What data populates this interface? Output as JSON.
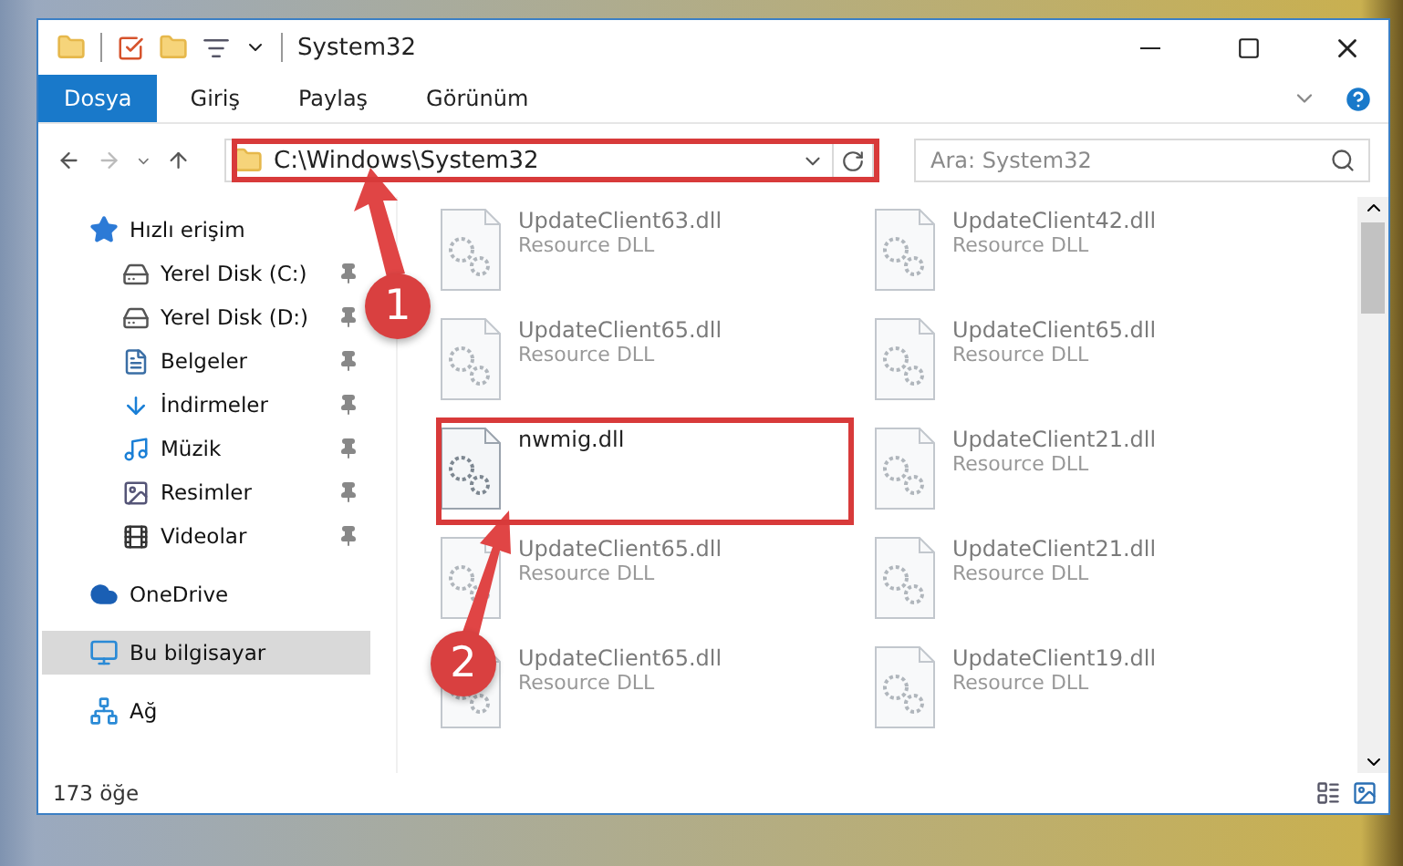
{
  "window": {
    "title": "System32"
  },
  "ribbon_tabs": [
    {
      "label": "Dosya",
      "selected": true
    },
    {
      "label": "Giriş",
      "selected": false
    },
    {
      "label": "Paylaş",
      "selected": false
    },
    {
      "label": "Görünüm",
      "selected": false
    }
  ],
  "address": {
    "path": "C:\\Windows\\System32"
  },
  "search": {
    "placeholder": "Ara: System32"
  },
  "sidebar": {
    "items": [
      {
        "label": "Hızlı erişim",
        "selected": false,
        "children": [
          {
            "label": "Yerel Disk (C:)",
            "pinned": true
          },
          {
            "label": "Yerel Disk (D:)",
            "pinned": true
          },
          {
            "label": "Belgeler",
            "pinned": true
          },
          {
            "label": "İndirmeler",
            "pinned": true
          },
          {
            "label": "Müzik",
            "pinned": true
          },
          {
            "label": "Resimler",
            "pinned": true
          },
          {
            "label": "Videolar",
            "pinned": true
          }
        ]
      },
      {
        "label": "OneDrive",
        "selected": false
      },
      {
        "label": "Bu bilgisayar",
        "selected": true
      },
      {
        "label": "Ağ",
        "selected": false
      }
    ]
  },
  "files": [
    {
      "name": "UpdateClient63.dll",
      "type": "Resource DLL",
      "dimmed": true
    },
    {
      "name": "UpdateClient42.dll",
      "type": "Resource DLL",
      "dimmed": true
    },
    {
      "name": "UpdateClient65.dll",
      "type": "Resource DLL",
      "dimmed": true
    },
    {
      "name": "UpdateClient65.dll",
      "type": "Resource DLL",
      "dimmed": true
    },
    {
      "name": "nwmig.dll",
      "dimmed": false
    },
    {
      "name": "UpdateClient21.dll",
      "type": "Resource DLL",
      "dimmed": true
    },
    {
      "name": "UpdateClient65.dll",
      "type": "Resource DLL",
      "dimmed": true
    },
    {
      "name": "UpdateClient21.dll",
      "type": "Resource DLL",
      "dimmed": true
    },
    {
      "name": "UpdateClient65.dll",
      "type": "Resource DLL",
      "dimmed": true
    },
    {
      "name": "UpdateClient19.dll",
      "type": "Resource DLL",
      "dimmed": true
    }
  ],
  "status_bar": {
    "item_count": "173 öğe"
  },
  "annotations": [
    {
      "label": "1"
    },
    {
      "label": "2"
    }
  ]
}
